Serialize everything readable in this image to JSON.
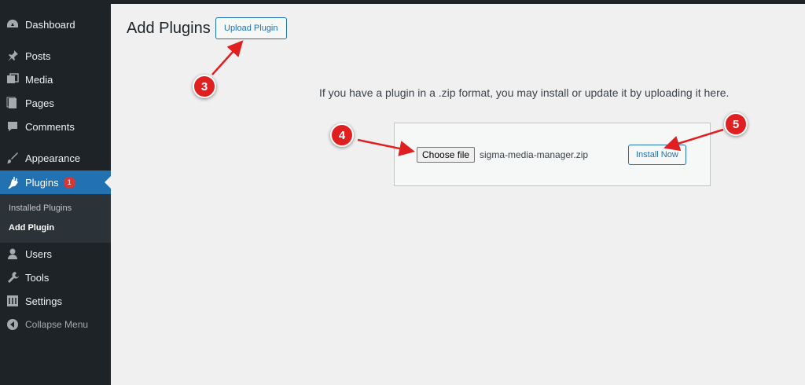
{
  "sidebar": {
    "items": [
      {
        "label": "Dashboard",
        "icon": "dashboard-icon"
      },
      {
        "label": "Posts",
        "icon": "pin-icon"
      },
      {
        "label": "Media",
        "icon": "media-icon"
      },
      {
        "label": "Pages",
        "icon": "pages-icon"
      },
      {
        "label": "Comments",
        "icon": "comment-icon"
      },
      {
        "label": "Appearance",
        "icon": "brush-icon"
      },
      {
        "label": "Plugins",
        "icon": "plugin-icon",
        "badge": "1"
      },
      {
        "label": "Users",
        "icon": "user-icon"
      },
      {
        "label": "Tools",
        "icon": "wrench-icon"
      },
      {
        "label": "Settings",
        "icon": "settings-icon"
      },
      {
        "label": "Collapse Menu",
        "icon": "collapse-icon"
      }
    ],
    "submenu": [
      {
        "label": "Installed Plugins"
      },
      {
        "label": "Add Plugin"
      }
    ]
  },
  "main": {
    "title": "Add Plugins",
    "upload_button": "Upload Plugin",
    "help_text": "If you have a plugin in a .zip format, you may install or update it by uploading it here.",
    "choose_file": "Choose file",
    "file_name": "sigma-media-manager.zip",
    "install_button": "Install Now"
  },
  "annotations": {
    "steps": [
      "3",
      "4",
      "5"
    ],
    "color": "#e02020"
  },
  "colors": {
    "sidebar_bg": "#1d2327",
    "accent": "#2271b1",
    "badge": "#d63638"
  }
}
